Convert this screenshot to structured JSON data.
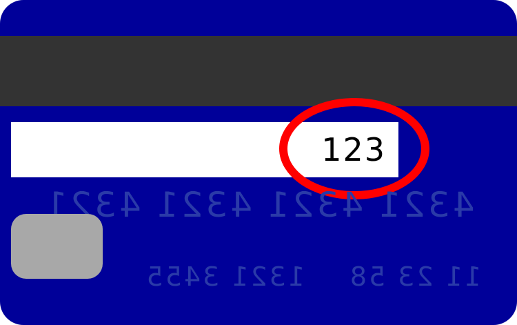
{
  "colors": {
    "card_background": "#000099",
    "magstripe": "#333333",
    "signature_panel": "#ffffff",
    "highlight_ring": "#ff0000",
    "cvv_text": "#000000",
    "mirrored_text": "#2a3aa8",
    "chip": "#a8a8a8"
  },
  "card": {
    "cvv": "123",
    "mirrored_number_groups": [
      "4321",
      "4321",
      "4321",
      "4321"
    ],
    "mirrored_line_left": "1321 3455",
    "mirrored_line_right": "11 23 58"
  },
  "icons": {
    "chip": "chip-icon",
    "highlight": "ellipse-highlight"
  }
}
